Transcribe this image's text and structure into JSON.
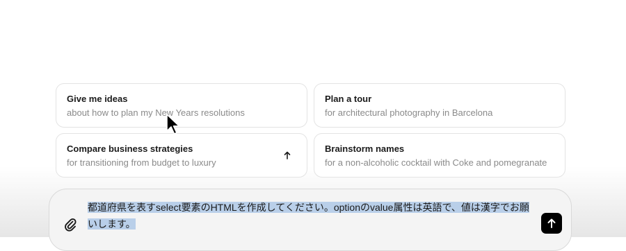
{
  "suggestions": [
    {
      "title": "Give me ideas",
      "subtitle": "about how to plan my New Years resolutions"
    },
    {
      "title": "Plan a tour",
      "subtitle": "for architectural photography in Barcelona"
    },
    {
      "title": "Compare business strategies",
      "subtitle": "for transitioning from budget to luxury"
    },
    {
      "title": "Brainstorm names",
      "subtitle": "for a non-alcoholic cocktail with Coke and pomegranate"
    }
  ],
  "composer": {
    "text": "都道府県を表すselect要素のHTMLを作成してください。optionのvalue属性は英語で、値は漢字でお願いします。",
    "selection_color": "#b9cfe9"
  },
  "icons": {
    "attach": "paperclip-icon",
    "send": "arrow-up-icon",
    "card_action": "arrow-up-icon",
    "cursor": "mouse-pointer-icon"
  },
  "colors": {
    "send_button": "#000000",
    "card_border": "#e3e3e3",
    "subtitle_text": "#8a8a8a"
  }
}
